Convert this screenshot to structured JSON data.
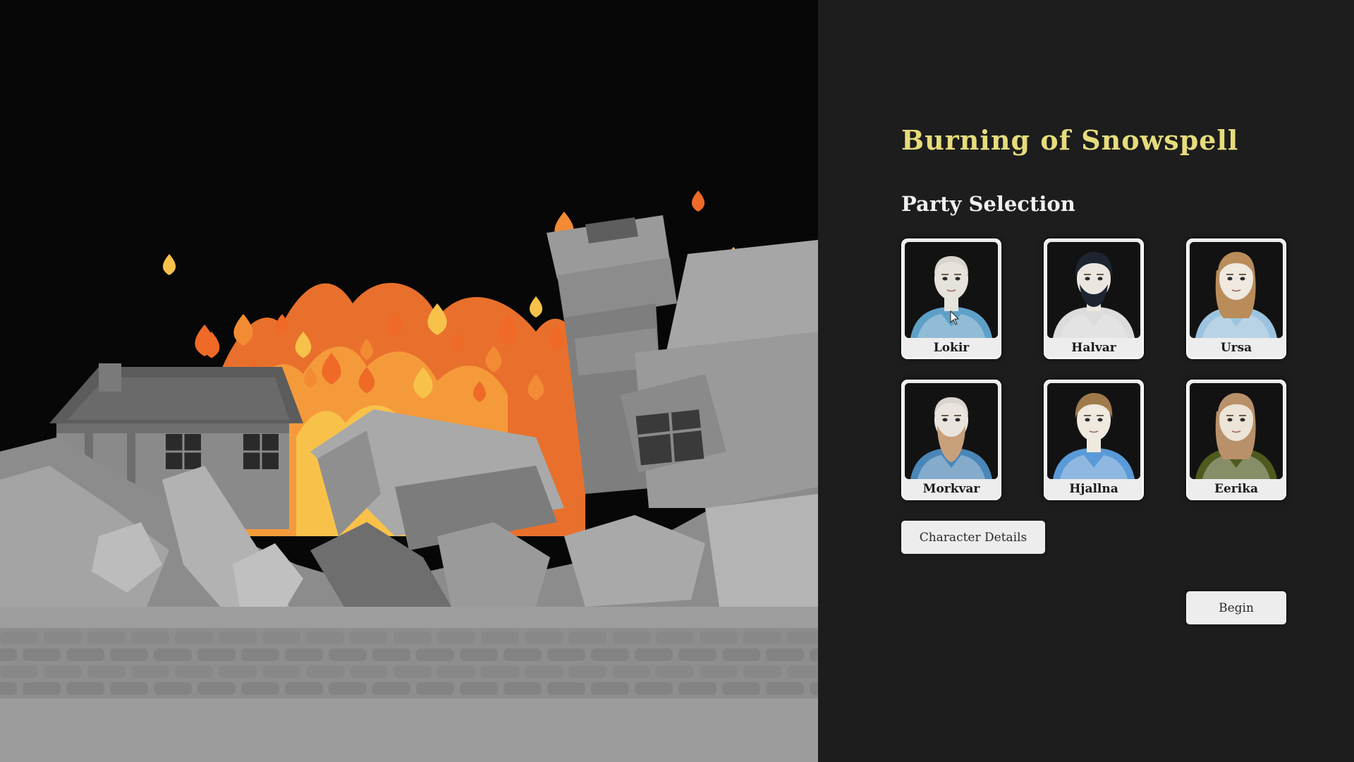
{
  "game": {
    "title": "Burning of Snowspell"
  },
  "party_selection": {
    "heading": "Party Selection",
    "characters": [
      {
        "name": "Lokir",
        "portrait": "bald-man-portrait",
        "hair": "#e8e8e8",
        "skin": "#e6e2dc",
        "outfit": "#5fa0c8"
      },
      {
        "name": "Halvar",
        "portrait": "dark-haired-bearded-man-portrait",
        "hair": "#1e2530",
        "skin": "#ebe7e0",
        "outfit": "#dcdcdc"
      },
      {
        "name": "Ursa",
        "portrait": "woman-with-ponytail-portrait",
        "hair": "#b98c5a",
        "skin": "#efe9e0",
        "outfit": "#9cc4e0"
      },
      {
        "name": "Morkvar",
        "portrait": "bald-bearded-man-portrait",
        "hair": "#c8a07a",
        "skin": "#e9e5de",
        "outfit": "#4a86b8"
      },
      {
        "name": "Hjallna",
        "portrait": "braided-woman-portrait",
        "hair": "#a07a4a",
        "skin": "#efe9df",
        "outfit": "#5a9ad8"
      },
      {
        "name": "Eerika",
        "portrait": "woman-in-green-portrait",
        "hair": "#b8906a",
        "skin": "#ece4d6",
        "outfit": "#4e5a1e"
      }
    ]
  },
  "buttons": {
    "character_details": "Character Details",
    "begin": "Begin"
  },
  "colors": {
    "title_accent": "#e6dc7c",
    "panel_background": "#1d1d1d",
    "fire_orange": "#f08a30",
    "fire_yellow": "#f8c24a"
  }
}
